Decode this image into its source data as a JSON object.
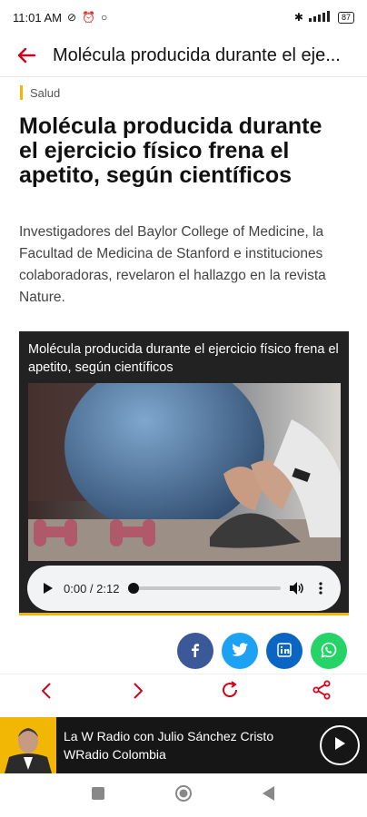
{
  "status": {
    "time": "11:01 AM",
    "battery": "87"
  },
  "appbar": {
    "title": "Molécula producida durante el eje..."
  },
  "article": {
    "category": "Salud",
    "headline": "Molécula producida durante el ejercicio físico frena el apetito, según científicos",
    "summary": "Investigadores del Baylor College of Medicine, la Facultad de Medicina de Stanford e instituciones colaboradoras, revelaron el hallazgo en la revista Nature.",
    "media_title": "Molécula producida durante el ejercicio físico frena el apetito, según científicos",
    "audio_time": "0:00 / 2:12",
    "audio_progress": 0
  },
  "share": [
    {
      "name": "facebook",
      "color": "#3b5998",
      "glyph": "f"
    },
    {
      "name": "twitter",
      "color": "#1da1f2",
      "glyph": "t"
    },
    {
      "name": "linkedin",
      "color": "#0a66c2",
      "glyph": "in"
    },
    {
      "name": "whatsapp",
      "color": "#25d366",
      "glyph": "w"
    }
  ],
  "player": {
    "title": "La W Radio con Julio Sánchez Cristo",
    "station": "WRadio Colombia"
  },
  "colors": {
    "accent": "#d0021b",
    "category_bar": "#f2b705"
  }
}
